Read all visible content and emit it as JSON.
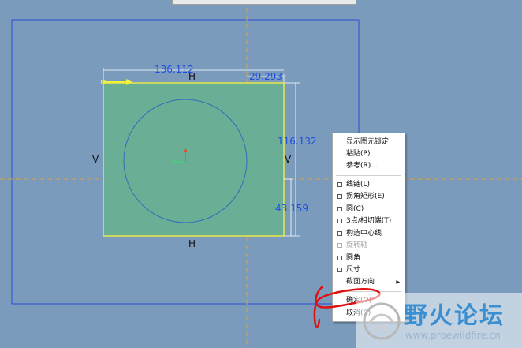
{
  "sketch": {
    "dim_width": "136.112",
    "dim_right_offset": "29.293",
    "dim_height": "116.132",
    "dim_lower": "43.159",
    "constraint_h": "H",
    "constraint_v": "V"
  },
  "context_menu": {
    "items": [
      {
        "label": "显示图元锁定",
        "type": "plain"
      },
      {
        "label": "粘贴(P)",
        "type": "plain"
      },
      {
        "label": "参考(R)...",
        "type": "plain"
      },
      {
        "label": "线链(L)",
        "type": "check"
      },
      {
        "label": "拐角矩形(E)",
        "type": "check"
      },
      {
        "label": "圆(C)",
        "type": "check"
      },
      {
        "label": "3点/相切端(T)",
        "type": "check"
      },
      {
        "label": "构造中心线",
        "type": "check"
      },
      {
        "label": "旋转轴",
        "type": "check-disabled"
      },
      {
        "label": "圆角",
        "type": "check"
      },
      {
        "label": "尺寸",
        "type": "check"
      },
      {
        "label": "截面方向",
        "type": "submenu"
      },
      {
        "label": "确定(O)",
        "type": "plain"
      },
      {
        "label": "取消(C)",
        "type": "plain"
      }
    ]
  },
  "watermark": {
    "title": "野火论坛",
    "url": "www.proewildfire.cn"
  },
  "colors": {
    "background": "#7b9bbd",
    "rect_fill": "#6bae96",
    "sketch_line": "#e8e84a",
    "dimension_text": "#1e4fe0",
    "centerline": "#d9a13a",
    "annotation_red": "#e01010"
  }
}
